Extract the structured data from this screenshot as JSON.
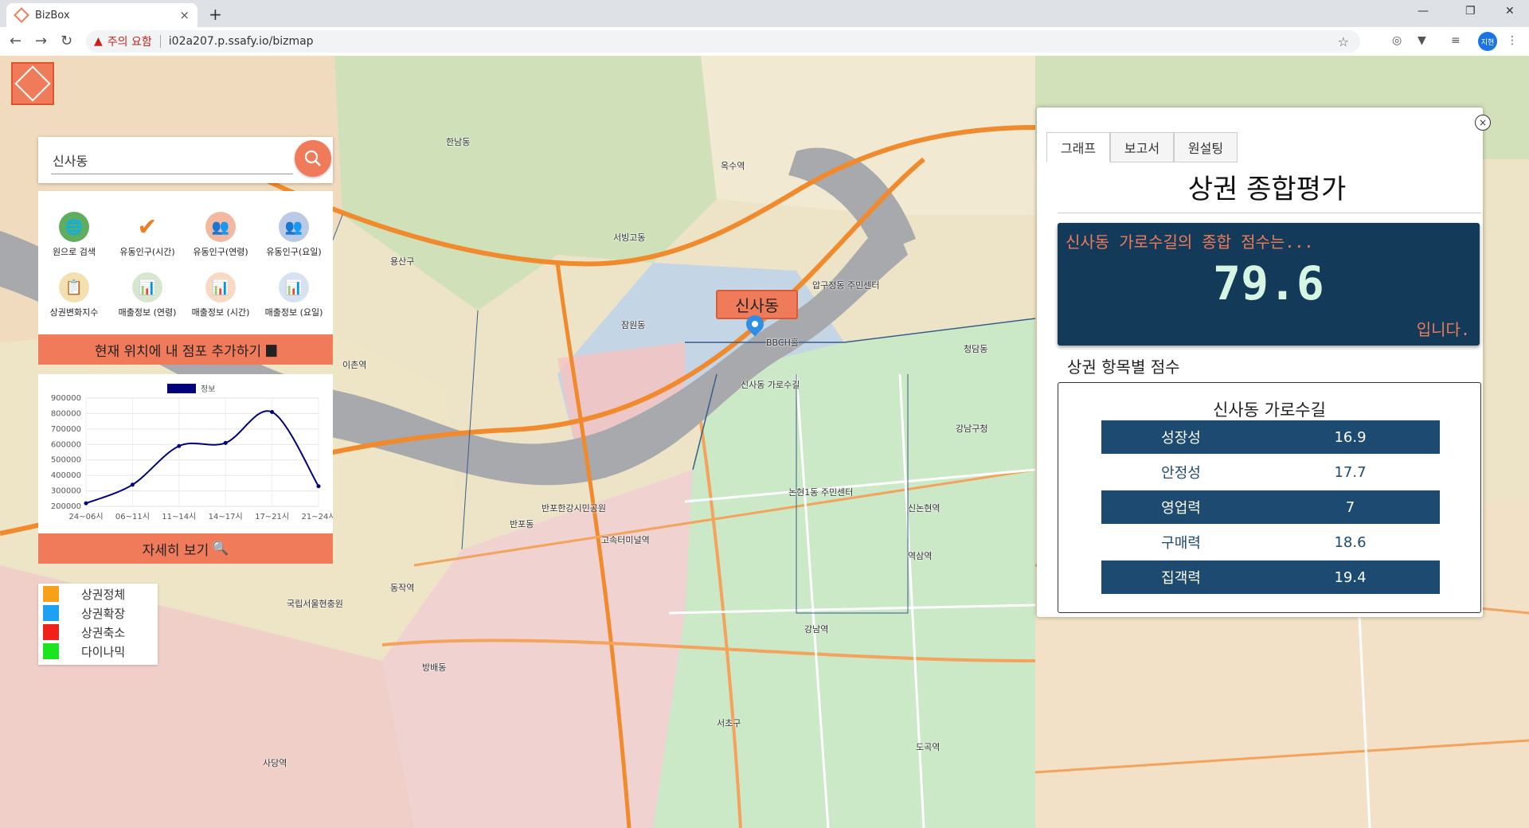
{
  "browser": {
    "tab_title": "BizBox",
    "tab_close": "×",
    "new_tab": "+",
    "warning": "주의 요함",
    "url": "i02a207.p.ssafy.io/bizmap",
    "profile": "지현"
  },
  "search": {
    "value": "신사동",
    "clear": "×"
  },
  "menu": [
    {
      "label": "원으로 검색",
      "icon": "globe-icon",
      "color": "#5fae5f"
    },
    {
      "label": "유동인구(시간)",
      "icon": "check-icon",
      "color": "#f07b20"
    },
    {
      "label": "유동인구(연령)",
      "icon": "people-icon",
      "color": "#f2b9a0"
    },
    {
      "label": "유동인구(요일)",
      "icon": "people-icon",
      "color": "#b9c9e6"
    },
    {
      "label": "상권변화지수",
      "icon": "report-icon",
      "color": "#f3e0b0"
    },
    {
      "label": "매출정보 (연령)",
      "icon": "bar-chart-icon",
      "color": "#d8e6d0"
    },
    {
      "label": "매출정보 (시간)",
      "icon": "bar-chart-icon",
      "color": "#f7d9c4"
    },
    {
      "label": "매출정보 (요일)",
      "icon": "bar-chart-icon",
      "color": "#d6e2f2"
    }
  ],
  "add_store_button": "현재 위치에 내 점포 추가하기",
  "detail_button": "자세히 보기",
  "chart_data": {
    "type": "line",
    "categories": [
      "24~06시",
      "06~11시",
      "11~14시",
      "14~17시",
      "17~21시",
      "21~24시"
    ],
    "series": [
      {
        "name": "정보",
        "values": [
          220000,
          340000,
          590000,
          610000,
          810000,
          330000
        ]
      }
    ],
    "yticks": [
      "900000",
      "800000",
      "700000",
      "600000",
      "500000",
      "400000",
      "300000",
      "200000"
    ],
    "ylim": [
      200000,
      900000
    ],
    "color": "#00007a"
  },
  "legend": [
    {
      "label": "상권정체",
      "color": "#f7a11a"
    },
    {
      "label": "상권확장",
      "color": "#1da1f2"
    },
    {
      "label": "상권축소",
      "color": "#f0201a"
    },
    {
      "label": "다이나믹",
      "color": "#19e61f"
    }
  ],
  "map": {
    "place_label": "신사동",
    "labels": [
      "한남동",
      "용산구",
      "서빙고동",
      "옥수역",
      "압구정동 주민센터",
      "신사동 가로수길",
      "BBCH홀",
      "잠원동",
      "반포동",
      "강남구청",
      "논현1동 주민센터",
      "역삼역",
      "강남역",
      "서초구",
      "방배동",
      "사당역",
      "도곡역",
      "반포한강시민공원",
      "이촌역",
      "동작역",
      "고속터미널역",
      "신논현역",
      "국립서울현충원",
      "청담동"
    ]
  },
  "panel": {
    "close": "×",
    "tabs": [
      "그래프",
      "보고서",
      "원설팅"
    ],
    "title": "상권 종합평가",
    "score_heading": "신사동 가로수길의 종합 점수는...",
    "score": "79.6",
    "score_tail": "입니다.",
    "subtitle": "상권 항목별 점수",
    "area_name": "신사동 가로수길",
    "items": [
      {
        "name": "성장성",
        "score": "16.9"
      },
      {
        "name": "안정성",
        "score": "17.7"
      },
      {
        "name": "영업력",
        "score": "7"
      },
      {
        "name": "구매력",
        "score": "18.6"
      },
      {
        "name": "집객력",
        "score": "19.4"
      }
    ]
  }
}
